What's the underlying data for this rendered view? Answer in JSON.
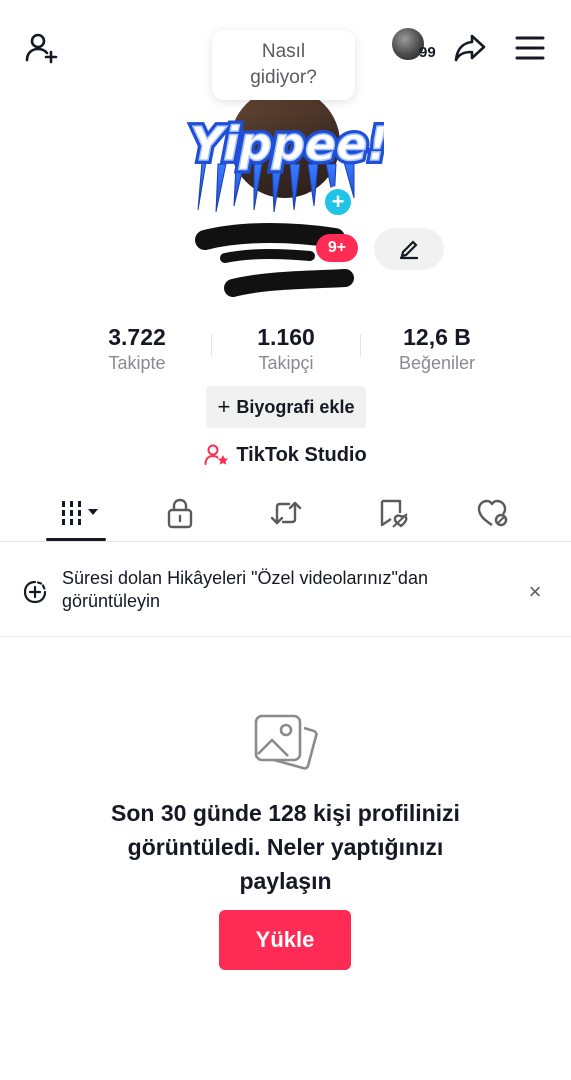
{
  "topbar": {
    "tooltip_text": "Nasıl gidiyor?",
    "story_count": "99",
    "icons": [
      "add-friend-icon",
      "share-icon",
      "menu-icon"
    ]
  },
  "profile": {
    "notification_badge": "9+",
    "edit_icon": "pencil-icon",
    "add_badge": "+"
  },
  "stats": [
    {
      "value": "3.722",
      "label": "Takipte"
    },
    {
      "value": "1.160",
      "label": "Takipçi"
    },
    {
      "value": "12,6 B",
      "label": "Beğeniler"
    }
  ],
  "bio_button": {
    "plus": "+",
    "label": "Biyografi ekle"
  },
  "studio": {
    "label": "TikTok Studio"
  },
  "tabs": [
    "videos-grid-icon",
    "lock-icon",
    "repost-icon",
    "favorites-icon",
    "liked-icon"
  ],
  "notice": {
    "text": "Süresi dolan Hikâyeleri \"Özel videolarınız\"dan görüntüleyin",
    "close": "×"
  },
  "empty_state": {
    "message": "Son 30 günde 128 kişi profilinizi görüntüledi. Neler yaptığınızı paylaşın",
    "upload_label": "Yükle"
  },
  "colors": {
    "accent": "#fe2c55",
    "text": "#161823",
    "muted": "#8a8b91",
    "button_bg": "#f1f1f2",
    "plus_badge": "#20c4e6"
  }
}
